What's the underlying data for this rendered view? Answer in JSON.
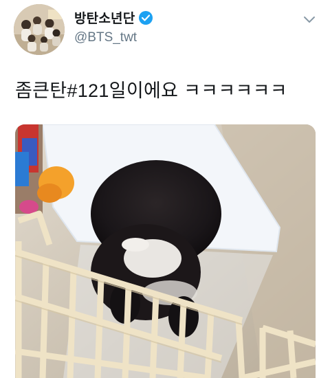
{
  "account": {
    "display_name": "방탄소년단",
    "handle": "@BTS_twt",
    "verified": true,
    "verified_color": "#1da1f2"
  },
  "tweet": {
    "text": "좀큰탄#121일이에요 ㅋㅋㅋㅋㅋㅋ"
  },
  "media": {
    "type": "video-frame",
    "alt_subject": "puppy in a playpen"
  },
  "icons": {
    "verified": "verified-badge-icon",
    "menu": "chevron-down-icon"
  },
  "colors": {
    "text": "#14171a",
    "muted": "#657786",
    "accent": "#1da1f2"
  }
}
